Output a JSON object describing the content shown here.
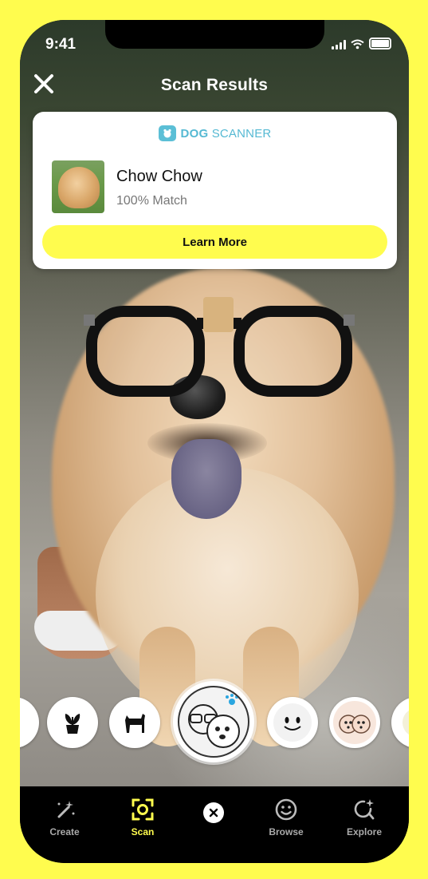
{
  "status_bar": {
    "time": "9:41"
  },
  "header": {
    "title": "Scan Results"
  },
  "result_card": {
    "brand_bold": "DOG",
    "brand_rest": " SCANNER",
    "breed": "Chow Chow",
    "match": "100% Match",
    "learn_more_label": "Learn More"
  },
  "lenses": [
    {
      "name": "partial-lens-icon"
    },
    {
      "name": "plant-icon"
    },
    {
      "name": "dog-icon"
    },
    {
      "name": "dog-glasses-lens-icon",
      "active": true
    },
    {
      "name": "smiley-face-lens-icon"
    },
    {
      "name": "dog-faces-lens-icon"
    },
    {
      "name": "partial-lens-icon"
    }
  ],
  "nav": {
    "items": [
      {
        "label": "Create",
        "icon": "magic-wand-icon"
      },
      {
        "label": "Scan",
        "icon": "scan-icon",
        "active": true
      },
      {
        "label": "Browse",
        "icon": "smiley-icon"
      },
      {
        "label": "Explore",
        "icon": "explore-icon"
      }
    ]
  },
  "colors": {
    "accent": "#FFFC4E",
    "brand_blue": "#55B9D3",
    "nav_bg": "#000000"
  }
}
